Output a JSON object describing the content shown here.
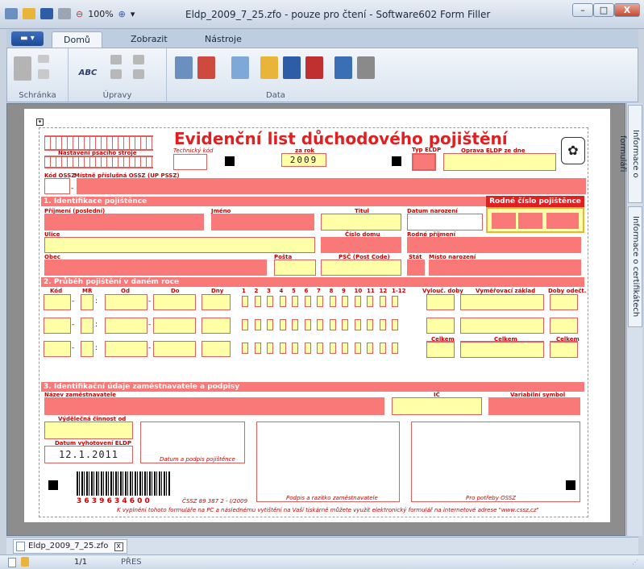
{
  "window": {
    "title": "Eldp_2009_7_25.zfo - pouze pro čtení - Software602 Form Filler",
    "zoom": "100%",
    "min": "–",
    "max": "□",
    "close": "X"
  },
  "ribbon": {
    "tabs": [
      "Domů",
      "Zobrazit",
      "Nástroje"
    ],
    "groups": {
      "schranka": "Schránka",
      "upravy": "Úpravy",
      "data": "Data"
    },
    "abc": "ABC"
  },
  "sidetabs": [
    "Informace o formuláři",
    "Informace o certifikátech"
  ],
  "form": {
    "title": "Evidenční list důchodového pojištění",
    "nastaveni": "Nastavení psacího stroje",
    "technicky_kod": "Technický kód",
    "za_rok": "za rok",
    "rok": "2009",
    "typ_eldp": "Typ ELDP",
    "oprava": "Oprava ELDP ze dne",
    "kod_ossz": "Kód OSSZ",
    "mistne": "Místně příslušná OSSZ (UP PSSZ)",
    "s1": "1. Identifikace pojištěnce",
    "rodne_cislo": "Rodné číslo pojištěnce",
    "prijmeni": "Příjmení (poslední)",
    "jmeno": "Jméno",
    "titul": "Titul",
    "datum_narozeni": "Datum narození",
    "ulice": "Ulice",
    "cislo_domu": "Číslo domu",
    "rodne_prijmeni": "Rodné příjmení",
    "obec": "Obec",
    "posta": "Pošta",
    "psc": "PSČ (Post Code)",
    "stat": "Stát",
    "misto_narozeni": "Místo narození",
    "s2": "2. Průběh pojištění v daném roce",
    "kod": "Kód",
    "mr": "MR",
    "od": "Od",
    "do": "Do",
    "dny": "Dny",
    "months": [
      "1",
      "2",
      "3",
      "4",
      "5",
      "6",
      "7",
      "8",
      "9",
      "10",
      "11",
      "12",
      "1-12"
    ],
    "vylouc": "Vylouč. doby",
    "vymerovaci": "Vyměřovací základ",
    "doby_odect": "Doby odečt.",
    "celkem": "Celkem",
    "s3": "3. Identifikační údaje zaměstnavatele a podpisy",
    "nazev": "Název zaměstnavatele",
    "ic": "IČ",
    "variabilni": "Variabilní symbol",
    "vydelecna": "Výdělečná činnost od",
    "datum_vyhotoveni": "Datum vyhotovení ELDP",
    "datum_hodnota": "12.1.2011",
    "podpis_pojistence": "Datum a podpis pojištěnce",
    "podpis_zamestnavatele": "Podpis a razítko zaměstnavatele",
    "potreby": "Pro potřeby OSSZ",
    "barcode_num": "3 6 3 9 6 3 4 6 0 0",
    "cssz": "ČSSZ 89 387 2 - I/2009",
    "footer": "K vyplnění tohoto formuláře na PC a následnému vytištění na Vaší tiskárně můžete využít elektronický formulář na internetové adrese \"www.cssz.cz\""
  },
  "doctab": {
    "label": "Eldp_2009_7_25.zfo",
    "close": "x"
  },
  "status": {
    "page": "1/1",
    "mode": "PŘES"
  }
}
